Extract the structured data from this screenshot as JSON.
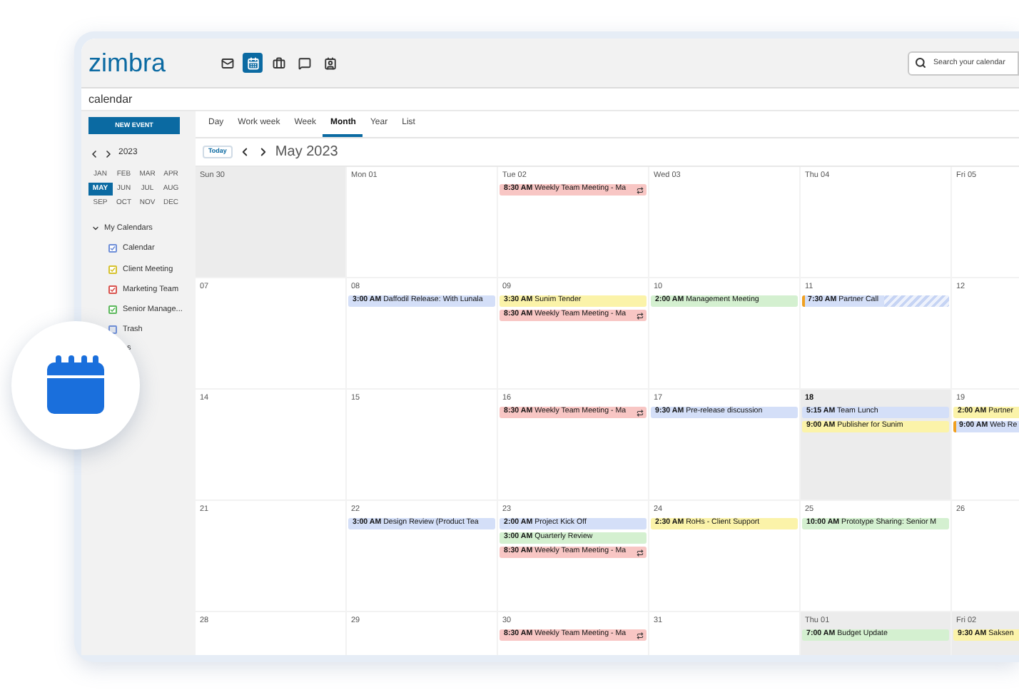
{
  "topbar": {
    "logo": "zimbra",
    "apps": [
      {
        "selected": false
      },
      {
        "selected": true
      },
      {
        "selected": false
      },
      {
        "selected": false
      },
      {
        "selected": false
      }
    ],
    "search": {
      "placeholder": "Search your calendar"
    }
  },
  "page_title": "calendar",
  "sidebar": {
    "new_event": "NEW EVENT",
    "year": "2023",
    "months": [
      {
        "label": "JAN",
        "selected": false
      },
      {
        "label": "FEB",
        "selected": false
      },
      {
        "label": "MAR",
        "selected": false
      },
      {
        "label": "APR",
        "selected": false
      },
      {
        "label": "MAY",
        "selected": true
      },
      {
        "label": "JUN",
        "selected": false
      },
      {
        "label": "JUL",
        "selected": false
      },
      {
        "label": "AUG",
        "selected": false
      },
      {
        "label": "SEP",
        "selected": false
      },
      {
        "label": "OCT",
        "selected": false
      },
      {
        "label": "NOV",
        "selected": false
      },
      {
        "label": "DEC",
        "selected": false
      }
    ],
    "section": {
      "label": "My Calendars",
      "expanded": true
    },
    "calendars": [
      {
        "label": "Calendar",
        "color": "#6f8fd8",
        "checked": true
      },
      {
        "label": "Client Meeting",
        "color": "#d6c22e",
        "checked": true
      },
      {
        "label": "Marketing Team",
        "color": "#d9534f",
        "checked": true
      },
      {
        "label": "Senior Manage...",
        "color": "#5cb85c",
        "checked": true
      },
      {
        "label": "Trash",
        "color": "#6f8fd8",
        "checked": false
      }
    ],
    "partial_item": "s"
  },
  "views": [
    {
      "label": "Day",
      "selected": false
    },
    {
      "label": "Work week",
      "selected": false
    },
    {
      "label": "Week",
      "selected": false
    },
    {
      "label": "Month",
      "selected": true
    },
    {
      "label": "Year",
      "selected": false
    },
    {
      "label": "List",
      "selected": false
    }
  ],
  "today_button": "Today",
  "period": "May 2023",
  "weeks": [
    [
      {
        "label": "Sun 30",
        "shaded": true,
        "today": false
      },
      {
        "label": "Mon 01",
        "shaded": false,
        "today": false
      },
      {
        "label": "Tue 02",
        "shaded": false,
        "today": false,
        "events": [
          {
            "time": "8:30 AM",
            "title": "Weekly Team Meeting - Ma",
            "color": "#f8c6c4",
            "recurring": true,
            "tentative": false
          }
        ]
      },
      {
        "label": "Wed 03",
        "shaded": false,
        "today": false
      },
      {
        "label": "Thu 04",
        "shaded": false,
        "today": false
      },
      {
        "label": "Fri 05",
        "shaded": false,
        "today": false
      }
    ],
    [
      {
        "label": "07",
        "shaded": false,
        "today": false
      },
      {
        "label": "08",
        "shaded": false,
        "today": false,
        "events": [
          {
            "time": "3:00 AM",
            "title": "Daffodil Release: With Lunala",
            "color": "#d4dff8",
            "recurring": false,
            "tentative": false
          }
        ]
      },
      {
        "label": "09",
        "shaded": false,
        "today": false,
        "events": [
          {
            "time": "3:30 AM",
            "title": "Sunim Tender",
            "color": "#fbf3a9",
            "recurring": false,
            "tentative": false
          },
          {
            "time": "8:30 AM",
            "title": "Weekly Team Meeting - Ma",
            "color": "#f8c6c4",
            "recurring": true,
            "tentative": false
          }
        ]
      },
      {
        "label": "10",
        "shaded": false,
        "today": false,
        "events": [
          {
            "time": "2:00 AM",
            "title": "Management Meeting",
            "color": "#d4f0d0",
            "recurring": false,
            "tentative": false
          }
        ]
      },
      {
        "label": "11",
        "shaded": false,
        "today": false,
        "events": [
          {
            "time": "7:30 AM",
            "title": "Partner Call",
            "color": "#d4dff8",
            "recurring": false,
            "tentative": true
          }
        ]
      },
      {
        "label": "12",
        "shaded": false,
        "today": false
      }
    ],
    [
      {
        "label": "14",
        "shaded": false,
        "today": false
      },
      {
        "label": "15",
        "shaded": false,
        "today": false
      },
      {
        "label": "16",
        "shaded": false,
        "today": false,
        "events": [
          {
            "time": "8:30 AM",
            "title": "Weekly Team Meeting - Ma",
            "color": "#f8c6c4",
            "recurring": true,
            "tentative": false
          }
        ]
      },
      {
        "label": "17",
        "shaded": false,
        "today": false,
        "events": [
          {
            "time": "9:30 AM",
            "title": "Pre-release discussion",
            "color": "#d4dff8",
            "recurring": false,
            "tentative": false
          }
        ]
      },
      {
        "label": "18",
        "shaded": true,
        "today": true,
        "events": [
          {
            "time": "5:15 AM",
            "title": "Team Lunch",
            "color": "#d4dff8",
            "recurring": false,
            "tentative": false
          },
          {
            "time": "9:00 AM",
            "title": "Publisher for Sunim",
            "color": "#fbf3a9",
            "recurring": false,
            "tentative": false
          }
        ]
      },
      {
        "label": "19",
        "shaded": false,
        "today": false,
        "events": [
          {
            "time": "2:00 AM",
            "title": "Partner",
            "color": "#fbf3a9",
            "tentative": false
          },
          {
            "time": "9:00 AM",
            "title": "Web Re",
            "color": "#d4dff8",
            "tentative": true
          }
        ]
      }
    ],
    [
      {
        "label": "21",
        "shaded": false,
        "today": false
      },
      {
        "label": "22",
        "shaded": false,
        "today": false,
        "events": [
          {
            "time": "3:00 AM",
            "title": "Design Review (Product Tea",
            "color": "#d4dff8",
            "recurring": false,
            "tentative": false
          }
        ]
      },
      {
        "label": "23",
        "shaded": false,
        "today": false,
        "events": [
          {
            "time": "2:00 AM",
            "title": "Project Kick Off",
            "color": "#d4dff8",
            "recurring": false,
            "tentative": false
          },
          {
            "time": "3:00 AM",
            "title": "Quarterly Review",
            "color": "#d4f0d0",
            "recurring": false,
            "tentative": false
          },
          {
            "time": "8:30 AM",
            "title": "Weekly Team Meeting - Ma",
            "color": "#f8c6c4",
            "recurring": true,
            "tentative": false
          }
        ]
      },
      {
        "label": "24",
        "shaded": false,
        "today": false,
        "events": [
          {
            "time": "2:30 AM",
            "title": "RoHs - Client Support",
            "color": "#fbf3a9",
            "recurring": false,
            "tentative": false
          }
        ]
      },
      {
        "label": "25",
        "shaded": false,
        "today": false,
        "events": [
          {
            "time": "10:00 AM",
            "title": "Prototype Sharing: Senior M",
            "color": "#d4f0d0",
            "recurring": false,
            "tentative": false
          }
        ]
      },
      {
        "label": "26",
        "shaded": false,
        "today": false
      }
    ],
    [
      {
        "label": "28",
        "shaded": false,
        "today": false
      },
      {
        "label": "29",
        "shaded": false,
        "today": false
      },
      {
        "label": "30",
        "shaded": false,
        "today": false,
        "events": [
          {
            "time": "8:30 AM",
            "title": "Weekly Team Meeting - Ma",
            "color": "#f8c6c4",
            "recurring": true,
            "tentative": false
          }
        ]
      },
      {
        "label": "31",
        "shaded": false,
        "today": false
      },
      {
        "label": "Thu 01",
        "shaded": true,
        "today": false,
        "events": [
          {
            "time": "7:00 AM",
            "title": "Budget Update",
            "color": "#d4f0d0",
            "recurring": false,
            "tentative": false
          }
        ]
      },
      {
        "label": "Fri 02",
        "shaded": true,
        "today": false,
        "events": [
          {
            "time": "9:30 AM",
            "title": "Saksen",
            "color": "#fbf3a9",
            "tentative": false
          }
        ]
      }
    ]
  ]
}
